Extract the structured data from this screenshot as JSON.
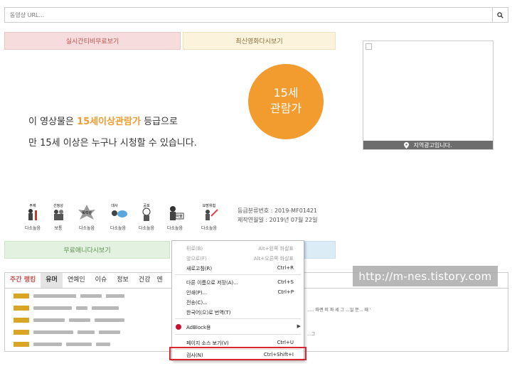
{
  "search": {
    "placeholder": "동영상 URL..."
  },
  "tabs": {
    "live": "실시간티비무료보기",
    "movie": "최신영화다시보기"
  },
  "rating_badge": {
    "line1": "15세",
    "line2": "관람가"
  },
  "notice": {
    "line1_prefix": "이 영상물은 ",
    "line1_highlight": "15세이상관람가",
    "line1_suffix": " 등급으로",
    "line2": "만 15세 이상은 누구나 시청할 수 있습니다."
  },
  "ad": {
    "label": "지역광고입니다."
  },
  "rating_icons": [
    {
      "name": "주제",
      "level": "다소높음"
    },
    {
      "name": "선정성",
      "level": "보통"
    },
    {
      "name": "폭력성",
      "level": "다소높음"
    },
    {
      "name": "대사",
      "level": "다소높음"
    },
    {
      "name": "공포",
      "level": "다소높음"
    },
    {
      "name": "약물",
      "level": "다소높음"
    },
    {
      "name": "모방위험",
      "level": "다소높음"
    }
  ],
  "classification": {
    "number": "등급분류번호 : 2019-MF01421",
    "date": "제작연월일 : 2019년 07월 22일"
  },
  "anime_button": "무료애니다시보기",
  "ranking": {
    "tabs": [
      "주간 랭킹",
      "유머",
      "연예인",
      "이슈",
      "정보",
      "건강",
      "엔"
    ],
    "rows": [
      "",
      "",
      "",
      "",
      ""
    ],
    "right_texts": [
      "",
      "..... 파랜 미 파 세 그 ...일 문 .. 때 '",
      "",
      "...그",
      ""
    ]
  },
  "watermark": "http://m-nes.tistory.com",
  "context_menu": {
    "items": [
      {
        "label": "뒤로(B)",
        "shortcut": "Alt+왼쪽 화살표",
        "disabled": true
      },
      {
        "label": "앞으로(F)",
        "shortcut": "Alt+오른쪽 화살표",
        "disabled": true
      },
      {
        "label": "새로고침(R)",
        "shortcut": "Ctrl+R",
        "disabled": false
      },
      {
        "label": "다른 이름으로 저장(A)...",
        "shortcut": "Ctrl+S",
        "disabled": false
      },
      {
        "label": "인쇄(P)...",
        "shortcut": "Ctrl+P",
        "disabled": false
      },
      {
        "label": "전송(C)...",
        "shortcut": "",
        "disabled": false
      },
      {
        "label": "한국어(으)로 번역(T)",
        "shortcut": "",
        "disabled": false
      },
      {
        "label": "AdBlock용",
        "shortcut": "",
        "disabled": false
      },
      {
        "label": "페이지 소스 보기(V)",
        "shortcut": "Ctrl+U",
        "disabled": false
      },
      {
        "label": "검사(N)",
        "shortcut": "Ctrl+Shift+I",
        "disabled": false
      }
    ]
  },
  "colors": {
    "accent_orange": "#f29b2f",
    "highlight_red": "#d9262e",
    "rank_bar": "#d9a525"
  }
}
